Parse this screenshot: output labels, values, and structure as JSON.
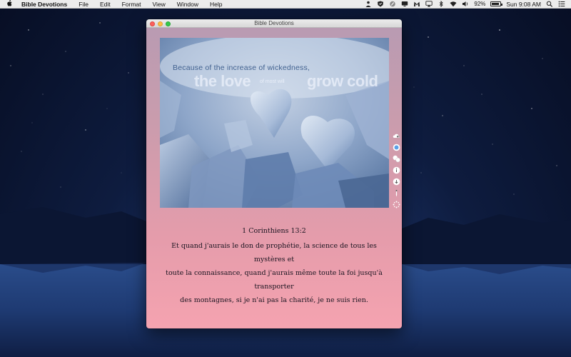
{
  "menubar": {
    "app_name": "Bible Devotions",
    "items": [
      "File",
      "Edit",
      "Format",
      "View",
      "Window",
      "Help"
    ],
    "battery_percent": "92%",
    "battery_level": 0.92,
    "clock": "Sun 9:08 AM"
  },
  "window": {
    "title": "Bible Devotions"
  },
  "image": {
    "line1": "Because of the increase of wickedness,",
    "word_left": "the love",
    "word_small": "of most will",
    "word_right": "grow cold"
  },
  "verse": {
    "reference": "1 Corinthiens 13:2",
    "lines": [
      "Et quand j'aurais le don de prophétie, la science de tous les mystères et",
      "toute la connaissance, quand j'aurais même toute la foi jusqu'à transporter",
      "des montagnes, si je n'ai pas la charité, je ne suis rien."
    ]
  },
  "sidebar_tools": [
    "cloud-upload-icon",
    "circle-select-icon",
    "bubbles-icon",
    "info-icon",
    "download-icon",
    "pen-icon",
    "sparkle-icon"
  ],
  "colors": {
    "close": "#fc605c",
    "minimize": "#fdbc40",
    "maximize": "#34c84a"
  }
}
